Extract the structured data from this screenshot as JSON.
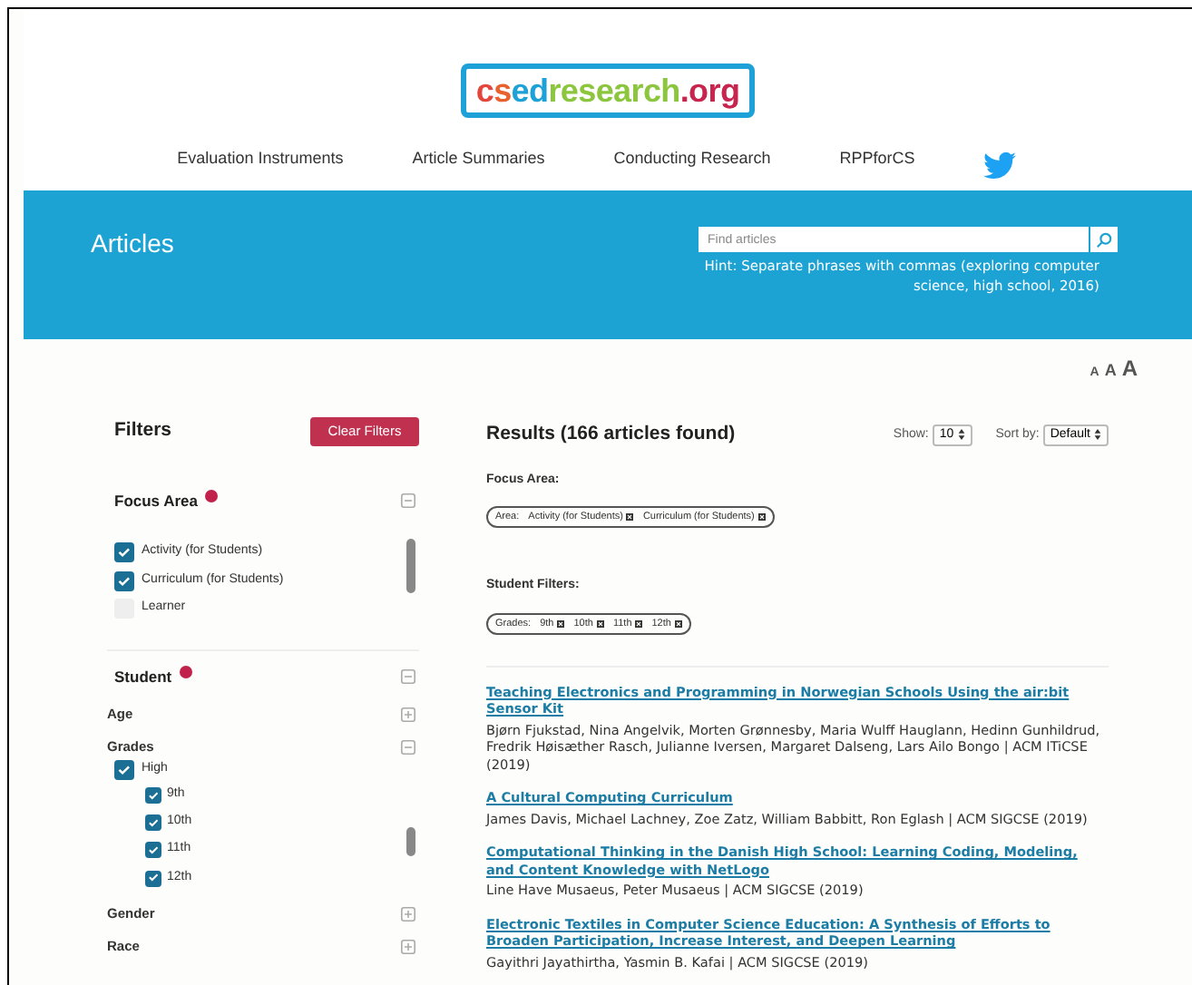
{
  "logo": [
    {
      "text": "c",
      "color": "#e2463c"
    },
    {
      "text": "s",
      "color": "#e8612f"
    },
    {
      "text": "ed",
      "color": "#1da1d6"
    },
    {
      "text": "research",
      "color": "#8cc63f"
    },
    {
      "text": ".org",
      "color": "#c7254e"
    }
  ],
  "nav": [
    "Evaluation Instruments",
    "Article Summaries",
    "Conducting Research",
    "RPPforCS"
  ],
  "banner": {
    "title": "Articles",
    "search": {
      "placeholder": "Find articles"
    },
    "hint": "Hint: Separate phrases with commas (exploring computer science, high school, 2016)"
  },
  "font_sizes": [
    "A",
    "A",
    "A"
  ],
  "filters": {
    "title": "Filters",
    "clear_button": "Clear Filters",
    "focus_area": {
      "title": "Focus Area",
      "expanded": true,
      "options": [
        {
          "label": "Activity (for Students)",
          "checked": true
        },
        {
          "label": "Curriculum (for Students)",
          "checked": true
        },
        {
          "label": "Learner",
          "checked": false
        }
      ]
    },
    "student": {
      "title": "Student",
      "expanded": true,
      "groups": [
        {
          "label": "Age",
          "expanded": false
        },
        {
          "label": "Grades",
          "expanded": true,
          "children": [
            {
              "label": "High",
              "checked": true,
              "children": [
                {
                  "label": "9th",
                  "checked": true
                },
                {
                  "label": "10th",
                  "checked": true
                },
                {
                  "label": "11th",
                  "checked": true
                },
                {
                  "label": "12th",
                  "checked": true
                }
              ]
            }
          ]
        },
        {
          "label": "Gender",
          "expanded": false
        },
        {
          "label": "Race",
          "expanded": false
        }
      ]
    }
  },
  "results": {
    "heading": "Results (166 articles found)",
    "show_label": "Show:",
    "show_value": "10",
    "sort_label": "Sort by:",
    "sort_value": "Default",
    "filter_groups": [
      {
        "title": "Focus Area:",
        "prefix": "Area:",
        "tags": [
          "Activity (for Students)",
          "Curriculum (for Students)"
        ]
      },
      {
        "title": "Student Filters:",
        "prefix": "Grades:",
        "tags": [
          "9th",
          "10th",
          "11th",
          "12th"
        ]
      }
    ],
    "articles": [
      {
        "title": "Teaching Electronics and Programming in Norwegian Schools Using the air:bit Sensor Kit",
        "meta": "Bjørn Fjukstad, Nina Angelvik, Morten Grønnesby, Maria Wulff Hauglann, Hedinn Gunhildrud, Fredrik Høisæther Rasch, Julianne Iversen, Margaret Dalseng, Lars Ailo Bongo | ACM ITiCSE (2019)"
      },
      {
        "title": "A Cultural Computing Curriculum",
        "meta": "James Davis, Michael Lachney, Zoe Zatz, William Babbitt, Ron Eglash | ACM SIGCSE (2019)"
      },
      {
        "title": "Computational Thinking in the Danish High School: Learning Coding, Modeling, and Content Knowledge with NetLogo",
        "meta": "Line Have Musaeus, Peter Musaeus | ACM SIGCSE (2019)"
      },
      {
        "title": "Electronic Textiles in Computer Science Education: A Synthesis of Efforts to Broaden Participation, Increase Interest, and Deepen Learning",
        "meta": "Gayithri Jayathirtha, Yasmin B. Kafai | ACM SIGCSE (2019)"
      }
    ]
  }
}
